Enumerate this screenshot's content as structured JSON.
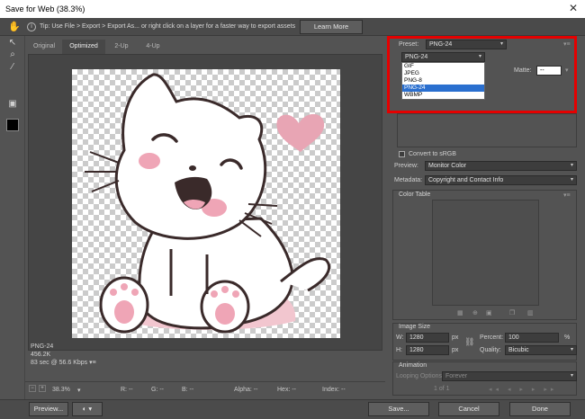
{
  "window": {
    "title": "Save for Web (38.3%)"
  },
  "tipbar": {
    "tip_text": "Tip: Use File > Export > Export As...   or right click on a layer for a faster way to export assets",
    "learn_more": "Learn More"
  },
  "tabs": [
    {
      "label": "Original"
    },
    {
      "label": "Optimized"
    },
    {
      "label": "2-Up"
    },
    {
      "label": "4-Up"
    }
  ],
  "stats": {
    "format": "PNG-24",
    "size": "456.2K",
    "time": "83 sec @ 56.6 Kbps"
  },
  "statusbar": {
    "zoom": "38.3%",
    "r": "R: --",
    "g": "G: --",
    "b": "B: --",
    "alpha": "Alpha: --",
    "hex": "Hex: --",
    "index": "Index: --"
  },
  "buttons": {
    "preview": "Preview...",
    "save": "Save...",
    "cancel": "Cancel",
    "done": "Done"
  },
  "settings": {
    "preset_label": "Preset:",
    "preset_value": "PNG-24",
    "format_value": "PNG-24",
    "format_options": [
      "GIF",
      "JPEG",
      "PNG-8",
      "PNG-24",
      "WBMP"
    ],
    "selected_option": "PNG-24",
    "matte_label": "Matte:",
    "matte_value": "--",
    "convert_srgb": "Convert to sRGB",
    "preview_label": "Preview:",
    "preview_value": "Monitor Color",
    "metadata_label": "Metadata:",
    "metadata_value": "Copyright and Contact Info"
  },
  "color_table": {
    "title": "Color Table"
  },
  "image_size": {
    "title": "Image Size",
    "w_label": "W:",
    "w_value": "1280",
    "h_label": "H:",
    "h_value": "1280",
    "unit": "px",
    "percent_label": "Percent:",
    "percent_value": "100",
    "percent_unit": "%",
    "quality_label": "Quality:",
    "quality_value": "Bicubic"
  },
  "animation": {
    "title": "Animation",
    "looping_label": "Looping Options:",
    "looping_value": "Forever",
    "frame": "1 of 1"
  },
  "colors": {
    "highlight": "#2a6fcf",
    "annotation_red": "#e50000"
  }
}
